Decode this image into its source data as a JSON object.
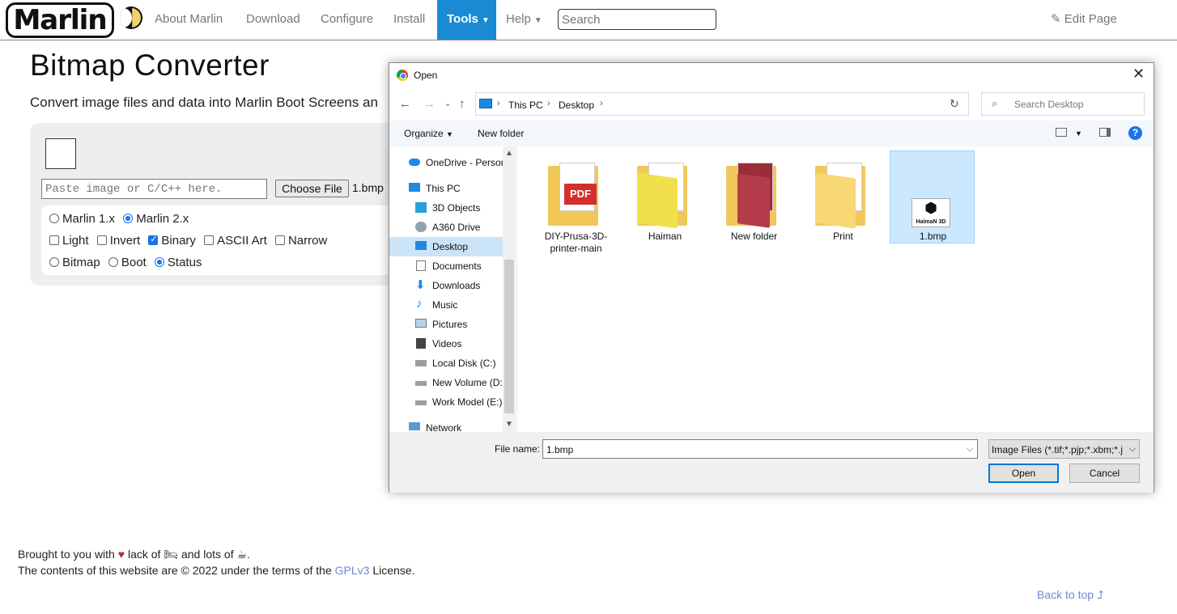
{
  "nav": {
    "logo": "Marlin",
    "items": [
      "About Marlin",
      "Download",
      "Configure",
      "Install",
      "Tools",
      "Help"
    ],
    "search_placeholder": "Search",
    "edit_page": "Edit Page"
  },
  "page": {
    "title": "Bitmap Converter",
    "subtitle": "Convert image files and data into Marlin Boot Screens an",
    "paste_placeholder": "Paste image or C/C++ here.",
    "choose_file": "Choose File",
    "chosen_file": "1.bmp",
    "row1": [
      "Marlin 1.x",
      "Marlin 2.x"
    ],
    "row2": [
      "Light",
      "Invert",
      "Binary",
      "ASCII Art",
      "Narrow"
    ],
    "row3": [
      "Bitmap",
      "Boot",
      "Status"
    ]
  },
  "footer": {
    "line1_a": "Brought to you with",
    "line1_b": "lack of",
    "line1_c": "and lots of",
    "line1_d": ".",
    "line2_a": "The contents of this website are © 2022 under the terms of the",
    "license": "GPLv3",
    "line2_b": "License.",
    "back_to_top": "Back to top"
  },
  "dialog": {
    "title": "Open",
    "breadcrumb": [
      "This PC",
      "Desktop"
    ],
    "search_placeholder": "Search Desktop",
    "organize": "Organize",
    "new_folder": "New folder",
    "nav_items": [
      {
        "label": "OneDrive - Person",
        "icon": "cloud-icon"
      },
      {
        "label": "This PC",
        "icon": "computer-icon"
      },
      {
        "label": "3D Objects",
        "icon": "cube-icon"
      },
      {
        "label": "A360 Drive",
        "icon": "drive-icon"
      },
      {
        "label": "Desktop",
        "icon": "desktop-icon"
      },
      {
        "label": "Documents",
        "icon": "document-icon"
      },
      {
        "label": "Downloads",
        "icon": "download-icon"
      },
      {
        "label": "Music",
        "icon": "music-icon"
      },
      {
        "label": "Pictures",
        "icon": "picture-icon"
      },
      {
        "label": "Videos",
        "icon": "video-icon"
      },
      {
        "label": "Local Disk (C:)",
        "icon": "disk-icon"
      },
      {
        "label": "New Volume (D:)",
        "icon": "disk-icon"
      },
      {
        "label": "Work Model (E:)",
        "icon": "disk-icon"
      },
      {
        "label": "Network",
        "icon": "network-icon"
      }
    ],
    "files": [
      {
        "name": "DIY-Prusa-3D-printer-main"
      },
      {
        "name": "Haiman"
      },
      {
        "name": "New folder"
      },
      {
        "name": "Print"
      },
      {
        "name": "1.bmp",
        "thumb_text": "HaimaN 3D"
      }
    ],
    "file_name_label": "File name:",
    "file_name_value": "1.bmp",
    "filter": "Image Files (*.tif;*.pjp;*.xbm;*.j",
    "open": "Open",
    "cancel": "Cancel",
    "pdf_badge": "PDF"
  }
}
